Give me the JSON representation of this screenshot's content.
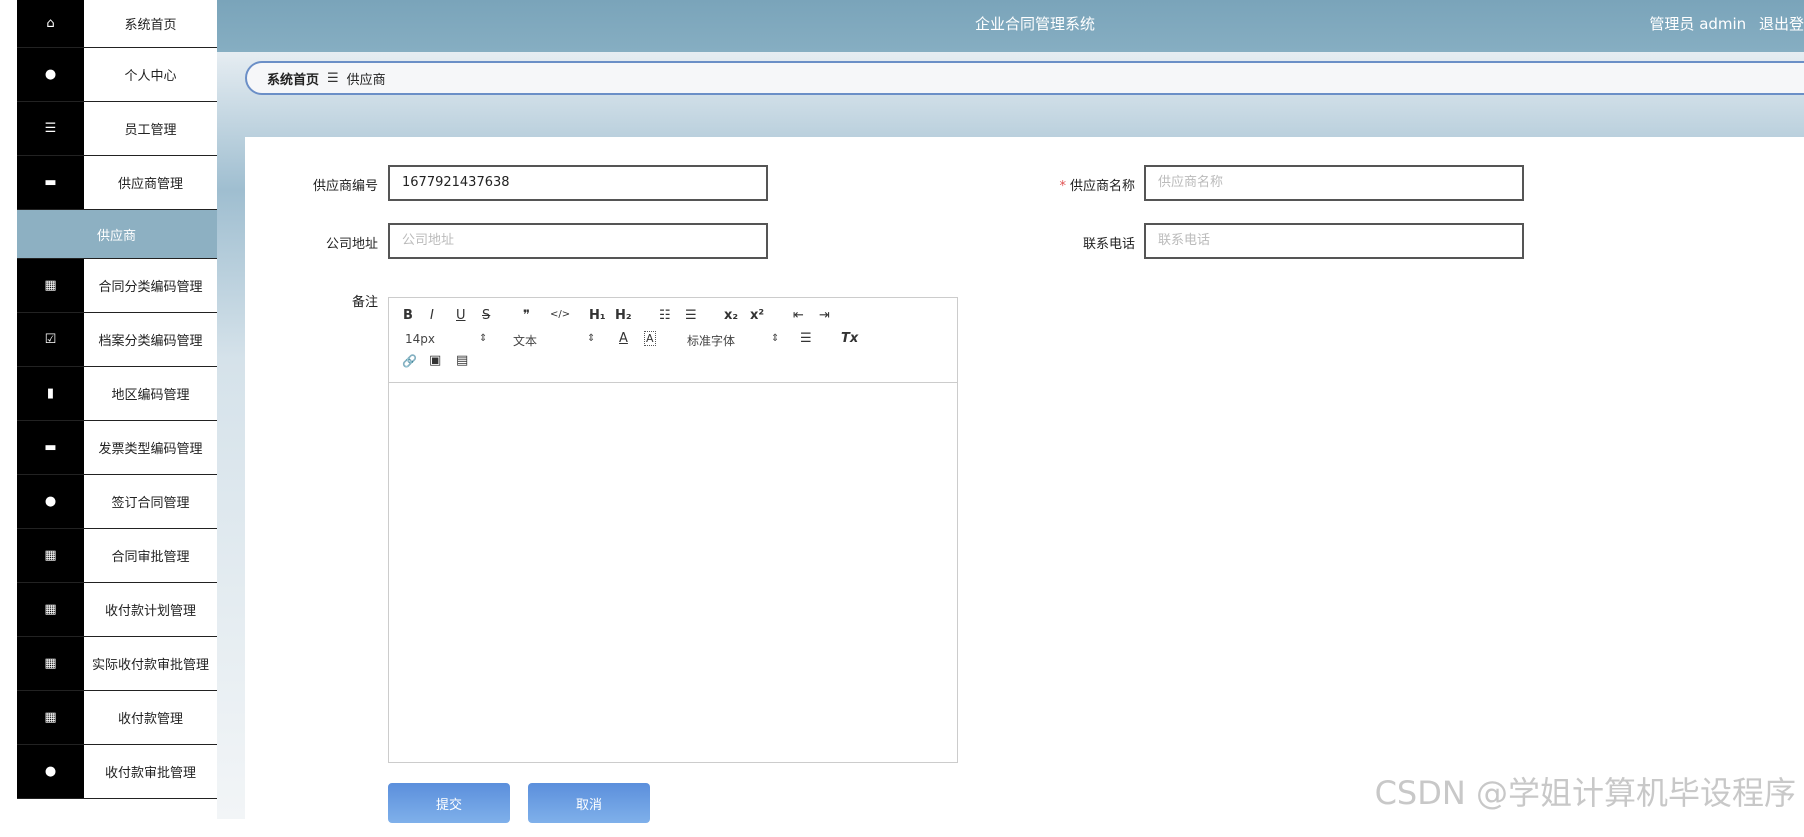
{
  "app": {
    "title": "企业合同管理系统",
    "user": "管理员 admin",
    "logout": "退出登"
  },
  "sidebar": {
    "items": [
      {
        "label": "系统首页",
        "icon": "home-icon"
      },
      {
        "label": "个人中心",
        "icon": "user-icon"
      },
      {
        "label": "员工管理",
        "icon": "list-icon"
      },
      {
        "label": "供应商管理",
        "icon": "monitor-icon"
      },
      {
        "label": "供应商",
        "icon": ""
      },
      {
        "label": "合同分类编码管理",
        "icon": "grid-icon"
      },
      {
        "label": "档案分类编码管理",
        "icon": "clipboard-icon"
      },
      {
        "label": "地区编码管理",
        "icon": "bar-chart-icon"
      },
      {
        "label": "发票类型编码管理",
        "icon": "monitor-icon"
      },
      {
        "label": "签订合同管理",
        "icon": "user-icon"
      },
      {
        "label": "合同审批管理",
        "icon": "grid-icon"
      },
      {
        "label": "收付款计划管理",
        "icon": "grid-icon"
      },
      {
        "label": "实际收付款审批管理",
        "icon": "grid-icon"
      },
      {
        "label": "收付款管理",
        "icon": "grid-icon"
      },
      {
        "label": "收付款审批管理",
        "icon": "user-icon"
      }
    ]
  },
  "breadcrumb": {
    "home": "系统首页",
    "sep": "☰",
    "current": "供应商"
  },
  "form": {
    "supplier_no_label": "供应商编号",
    "supplier_no_value": "1677921437638",
    "supplier_name_label": "供应商名称",
    "supplier_name_placeholder": "供应商名称",
    "required_mark": "*",
    "address_label": "公司地址",
    "address_placeholder": "公司地址",
    "phone_label": "联系电话",
    "phone_placeholder": "联系电话",
    "remark_label": "备注"
  },
  "editor": {
    "font_size": "14px",
    "paragraph": "文本",
    "font_family": "标准字体",
    "buttons": {
      "bold": "B",
      "italic": "I",
      "underline": "U",
      "strike": "S",
      "quote": "❞",
      "code": "</>",
      "h1": "H₁",
      "h2": "H₂",
      "ol": "☷",
      "ul": "☰",
      "sub": "x₂",
      "sup": "x²",
      "outdent": "⇤",
      "indent": "⇥",
      "color": "A",
      "bg": "A",
      "align": "☰",
      "clean": "Tx",
      "link": "🔗",
      "image": "▣",
      "video": "▤"
    }
  },
  "actions": {
    "submit": "提交",
    "cancel": "取消"
  },
  "watermark": "CSDN @学姐计算机毕设程序"
}
